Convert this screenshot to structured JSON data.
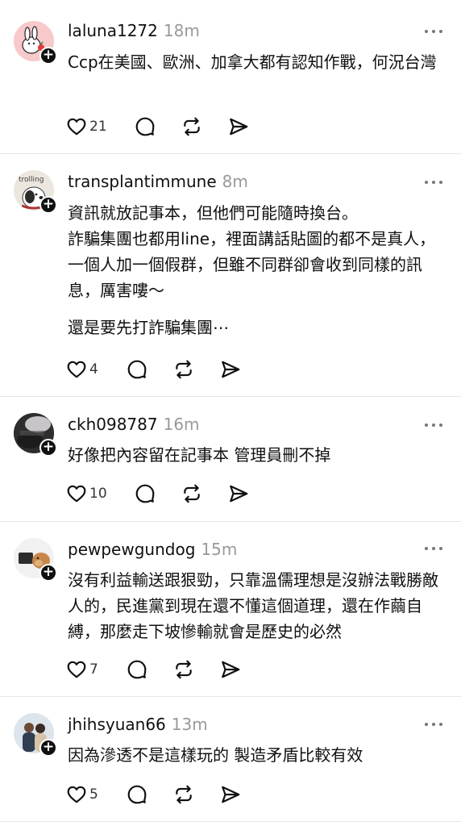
{
  "posts": [
    {
      "username": "laluna1272",
      "time": "18m",
      "paragraphs": [
        "Ccp在美國、歐洲、加拿大都有認知作戰，何況台灣"
      ],
      "likes": "21"
    },
    {
      "username": "transplantimmune",
      "time": "8m",
      "paragraphs": [
        "資訊就放記事本，但他們可能隨時換台。",
        "詐騙集團也都用line，裡面講話貼圖的都不是真人，一個人加一個假群，但雖不同群卻會收到同樣的訊息，厲害嘍～",
        "還是要先打詐騙集團⋯"
      ],
      "likes": "4"
    },
    {
      "username": "ckh098787",
      "time": "16m",
      "paragraphs": [
        "好像把內容留在記事本 管理員刪不掉"
      ],
      "likes": "10"
    },
    {
      "username": "pewpewgundog",
      "time": "15m",
      "paragraphs": [
        "沒有利益輸送跟狠勁，只靠溫儒理想是沒辦法戰勝敵人的，民進黨到現在還不懂這個道理，還在作繭自縛，那麼走下坡慘輸就會是歷史的必然"
      ],
      "likes": "7"
    },
    {
      "username": "jhihsyuan66",
      "time": "13m",
      "paragraphs": [
        "因為滲透不是這樣玩的 製造矛盾比較有效"
      ],
      "likes": "5"
    }
  ],
  "icons": {
    "like": "heart-icon",
    "reply": "speech-bubble-icon",
    "repost": "repost-icon",
    "share": "send-icon",
    "more": "more-dots-icon",
    "follow": "plus-icon"
  },
  "colors": {
    "text": "#101010",
    "secondary": "#999999",
    "divider": "#e6e6e6"
  }
}
